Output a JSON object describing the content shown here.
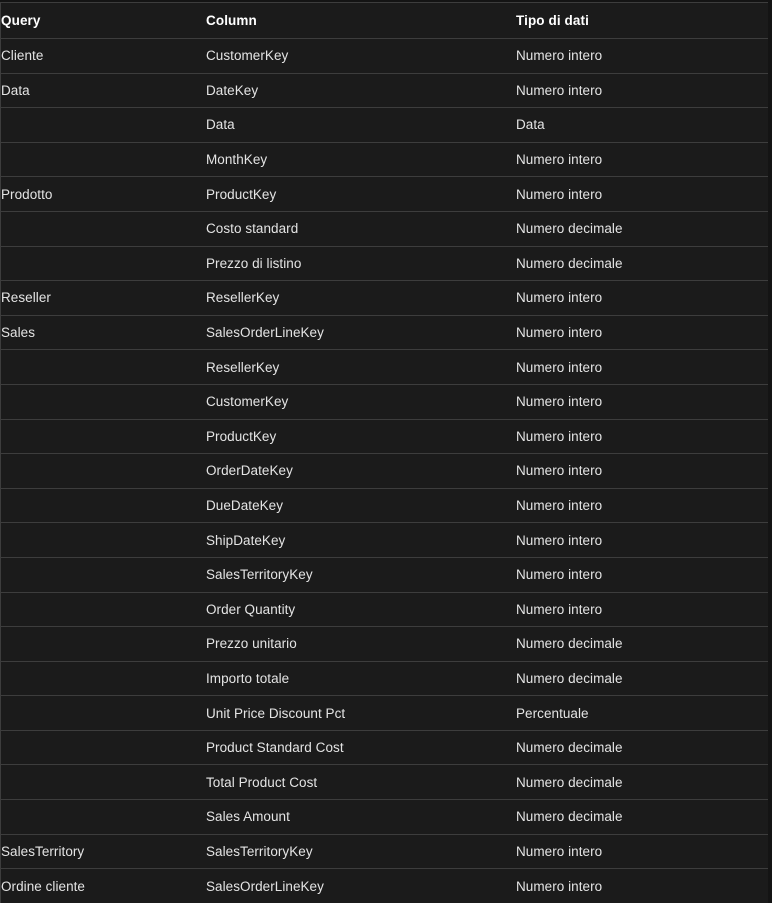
{
  "table": {
    "headers": {
      "query": "Query",
      "column": "Column",
      "type": "Tipo di dati"
    },
    "rows": [
      {
        "query": "Cliente",
        "column": "CustomerKey",
        "type": "Numero intero"
      },
      {
        "query": "Data",
        "column": "DateKey",
        "type": "Numero intero"
      },
      {
        "query": "",
        "column": "Data",
        "type": "Data"
      },
      {
        "query": "",
        "column": "MonthKey",
        "type": "Numero intero"
      },
      {
        "query": "Prodotto",
        "column": "ProductKey",
        "type": "Numero intero"
      },
      {
        "query": "",
        "column": "Costo standard",
        "type": "Numero decimale"
      },
      {
        "query": "",
        "column": "Prezzo di listino",
        "type": "Numero decimale"
      },
      {
        "query": "Reseller",
        "column": "ResellerKey",
        "type": "Numero intero"
      },
      {
        "query": "Sales",
        "column": "SalesOrderLineKey",
        "type": "Numero intero"
      },
      {
        "query": "",
        "column": "ResellerKey",
        "type": "Numero intero"
      },
      {
        "query": "",
        "column": "CustomerKey",
        "type": "Numero intero"
      },
      {
        "query": "",
        "column": "ProductKey",
        "type": "Numero intero"
      },
      {
        "query": "",
        "column": "OrderDateKey",
        "type": "Numero intero"
      },
      {
        "query": "",
        "column": "DueDateKey",
        "type": "Numero intero"
      },
      {
        "query": "",
        "column": "ShipDateKey",
        "type": "Numero intero"
      },
      {
        "query": "",
        "column": "SalesTerritoryKey",
        "type": "Numero intero"
      },
      {
        "query": "",
        "column": "Order Quantity",
        "type": "Numero intero"
      },
      {
        "query": "",
        "column": "Prezzo unitario",
        "type": "Numero decimale"
      },
      {
        "query": "",
        "column": "Importo totale",
        "type": "Numero decimale"
      },
      {
        "query": "",
        "column": "Unit Price Discount Pct",
        "type": "Percentuale"
      },
      {
        "query": "",
        "column": "Product Standard Cost",
        "type": "Numero decimale"
      },
      {
        "query": "",
        "column": "Total Product Cost",
        "type": "Numero decimale"
      },
      {
        "query": "",
        "column": "Sales Amount",
        "type": "Numero decimale"
      },
      {
        "query": "SalesTerritory",
        "column": "SalesTerritoryKey",
        "type": "Numero intero"
      },
      {
        "query": "Ordine cliente",
        "column": "SalesOrderLineKey",
        "type": "Numero intero"
      }
    ]
  },
  "theme": {
    "page_background": "#141414",
    "table_background": "#1b1b1b",
    "border_color": "#3d3d3d",
    "header_text_color": "#ffffff",
    "body_text_color": "#e4e4e4"
  }
}
